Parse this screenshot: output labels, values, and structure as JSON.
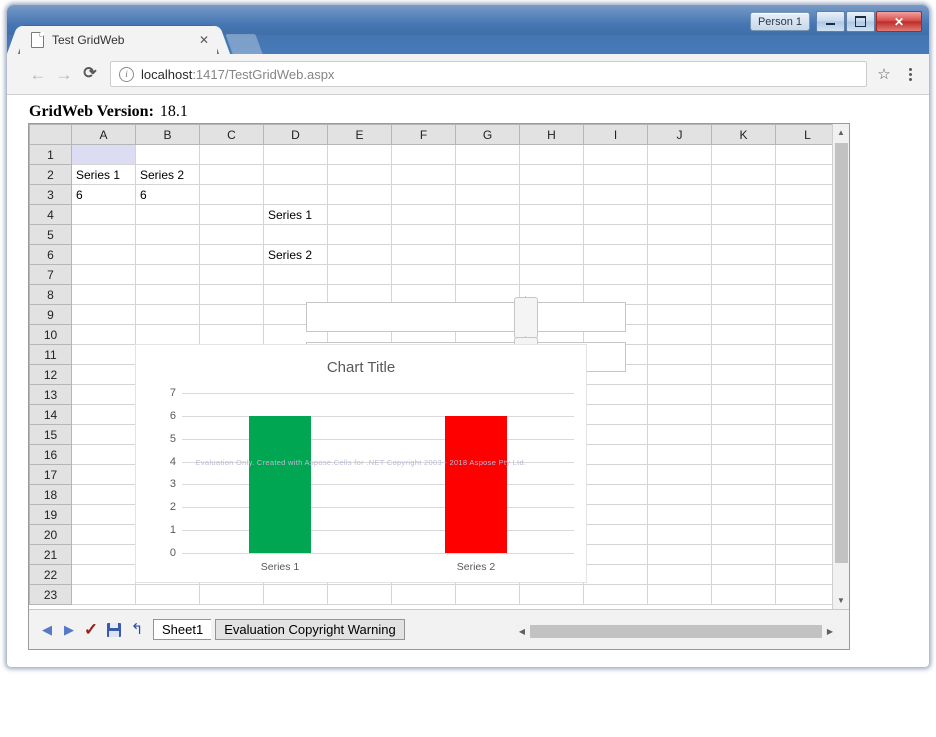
{
  "window": {
    "profile_label": "Person 1",
    "minimize_label": "Minimize",
    "maximize_label": "Maximize",
    "close_label": "✕"
  },
  "browser": {
    "tab": {
      "title": "Test GridWeb",
      "close_glyph": "✕",
      "favicon_name": "page-icon"
    },
    "newtab_label": "",
    "nav": {
      "back_glyph": "←",
      "forward_glyph": "→",
      "reload_glyph": "⟳"
    },
    "omnibox": {
      "info_glyph": "i",
      "url_host": "localhost",
      "url_rest": ":1417/TestGridWeb.aspx",
      "full_url": "localhost:1417/TestGridWeb.aspx"
    },
    "star_glyph": "☆",
    "menu_glyph": "⋮"
  },
  "page": {
    "version_label": "GridWeb Version:",
    "version_value": "18.1"
  },
  "grid": {
    "columns": [
      "A",
      "B",
      "C",
      "D",
      "E",
      "F",
      "G",
      "H",
      "I",
      "J",
      "K",
      "L"
    ],
    "rows": [
      "1",
      "2",
      "3",
      "4",
      "5",
      "6",
      "7",
      "8",
      "9",
      "10",
      "11",
      "12",
      "13",
      "14",
      "15",
      "16",
      "17",
      "18",
      "19",
      "20",
      "21",
      "22",
      "23"
    ],
    "selected_cell": "A1",
    "cells": {
      "A2": "Series 1",
      "B2": "Series 2",
      "A3": "6",
      "B3": "6",
      "D4": "Series 1",
      "D6": "Series 2"
    },
    "sliders": [
      {
        "name": "slider-series-1",
        "row": "4"
      },
      {
        "name": "slider-series-2",
        "row": "6"
      }
    ],
    "vscroll": {
      "up_glyph": "▲",
      "down_glyph": "▼"
    },
    "hscroll": {
      "left_glyph": "◀",
      "right_glyph": "▶"
    }
  },
  "chart_data": {
    "type": "bar",
    "title": "Chart Title",
    "categories": [
      "Series 1",
      "Series 2"
    ],
    "values": [
      6,
      6
    ],
    "colors": [
      "#00A651",
      "#FF0000"
    ],
    "xlabel": "",
    "ylabel": "",
    "ylim": [
      0,
      7
    ],
    "yticks": [
      0,
      1,
      2,
      3,
      4,
      5,
      6,
      7
    ],
    "grid": true,
    "legend": "none",
    "watermark": "Evaluation Only. Created with Aspose.Cells for .NET Copyright 2003 - 2018 Aspose Pty Ltd."
  },
  "sheetbar": {
    "prev_glyph": "◀",
    "next_glyph": "▶",
    "check_glyph": "✓",
    "undo_glyph": "↰",
    "save_name": "save-icon",
    "tabs": [
      {
        "label": "Sheet1",
        "active": true
      },
      {
        "label": "Evaluation Copyright Warning",
        "active": false
      }
    ]
  }
}
